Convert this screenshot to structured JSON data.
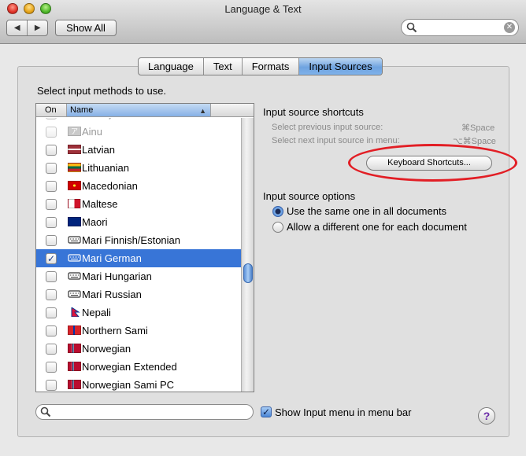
{
  "window": {
    "title": "Language & Text"
  },
  "toolbar": {
    "back_icon": "chevron-left-icon",
    "forward_icon": "chevron-right-icon",
    "show_all_label": "Show All",
    "search_value": ""
  },
  "tabs": [
    {
      "label": "Language",
      "active": false
    },
    {
      "label": "Text",
      "active": false
    },
    {
      "label": "Formats",
      "active": false
    },
    {
      "label": "Input Sources",
      "active": true
    }
  ],
  "list": {
    "heading": "Select input methods to use.",
    "columns": {
      "on": "On",
      "name": "Name"
    },
    "items": [
      {
        "label": "Romaji",
        "checked": true,
        "dimmed": true,
        "icon": "romaji-icon"
      },
      {
        "label": "Ainu",
        "checked": false,
        "dimmed": true,
        "icon": "ainu-icon"
      },
      {
        "label": "Latvian",
        "checked": false,
        "dimmed": false,
        "icon": "latvia-flag"
      },
      {
        "label": "Lithuanian",
        "checked": false,
        "dimmed": false,
        "icon": "lithuania-flag"
      },
      {
        "label": "Macedonian",
        "checked": false,
        "dimmed": false,
        "icon": "macedonia-flag"
      },
      {
        "label": "Maltese",
        "checked": false,
        "dimmed": false,
        "icon": "malta-flag"
      },
      {
        "label": "Maori",
        "checked": false,
        "dimmed": false,
        "icon": "new-zealand-flag"
      },
      {
        "label": "Mari Finnish/Estonian",
        "checked": false,
        "dimmed": false,
        "icon": "keyboard-icon"
      },
      {
        "label": "Mari German",
        "checked": true,
        "dimmed": false,
        "icon": "keyboard-icon",
        "selected": true
      },
      {
        "label": "Mari Hungarian",
        "checked": false,
        "dimmed": false,
        "icon": "keyboard-icon"
      },
      {
        "label": "Mari Russian",
        "checked": false,
        "dimmed": false,
        "icon": "keyboard-icon"
      },
      {
        "label": "Nepali",
        "checked": false,
        "dimmed": false,
        "icon": "nepal-flag"
      },
      {
        "label": "Northern Sami",
        "checked": false,
        "dimmed": false,
        "icon": "sami-flag"
      },
      {
        "label": "Norwegian",
        "checked": false,
        "dimmed": false,
        "icon": "norway-flag"
      },
      {
        "label": "Norwegian Extended",
        "checked": false,
        "dimmed": false,
        "icon": "norway-flag"
      },
      {
        "label": "Norwegian Sami PC",
        "checked": false,
        "dimmed": false,
        "icon": "norway-flag"
      }
    ]
  },
  "shortcuts": {
    "heading": "Input source shortcuts",
    "prev_label": "Select previous input source:",
    "prev_keys": "⌘Space",
    "next_label": "Select next input source in menu:",
    "next_keys": "⌥⌘Space",
    "button_label": "Keyboard Shortcuts..."
  },
  "options": {
    "heading": "Input source options",
    "radio1": "Use the same one in all documents",
    "radio2": "Allow a different one for each document",
    "selected": 1
  },
  "bottom": {
    "search_value": "",
    "show_menu_label": "Show Input menu in menu bar",
    "show_menu_checked": true,
    "help_label": "?"
  },
  "colors": {
    "selection": "#3875d7",
    "annotation": "#e21e25"
  }
}
